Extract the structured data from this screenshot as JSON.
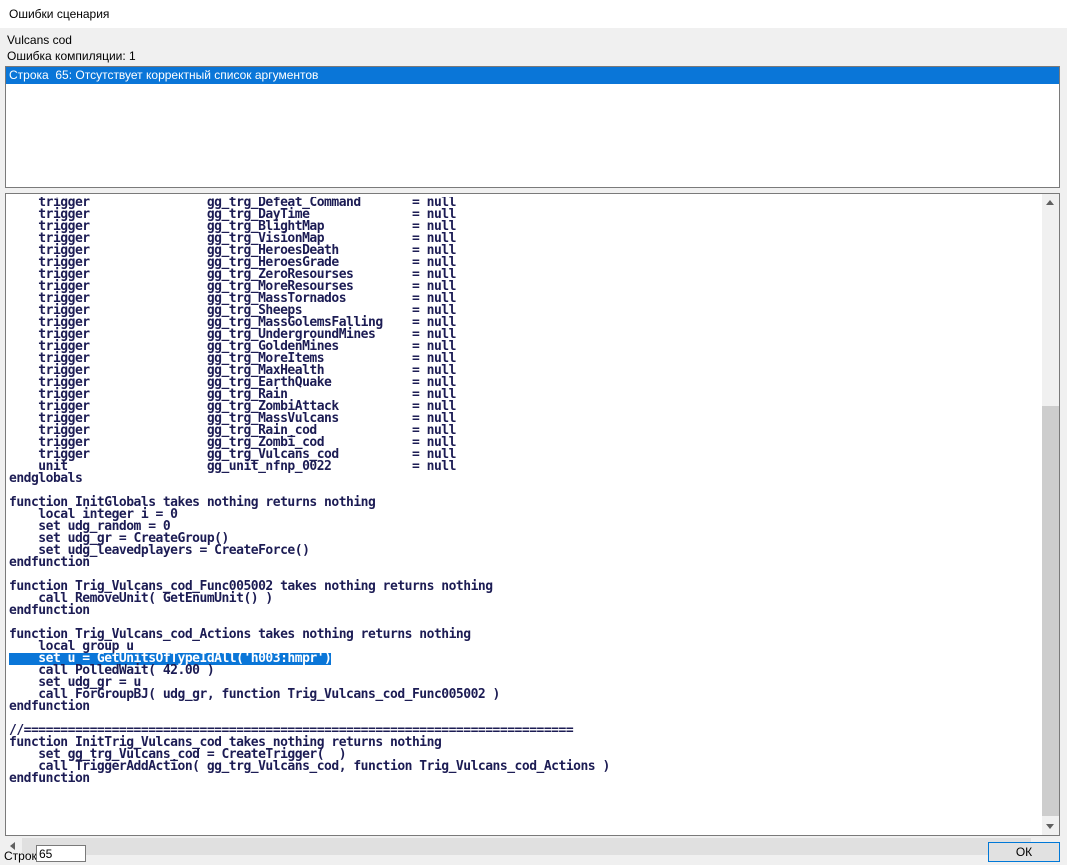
{
  "window": {
    "title": "Ошибки сценария"
  },
  "header": {
    "script_name": "Vulcans cod",
    "error_count": "Ошибка компиляции: 1"
  },
  "error_list": {
    "items": [
      {
        "text": "Строка  65: Отсутствует корректный список аргументов",
        "selected": true
      }
    ]
  },
  "code": {
    "highlighted_index": 38,
    "lines": [
      "    trigger                gg_trg_Defeat_Command       = null",
      "    trigger                gg_trg_DayTime              = null",
      "    trigger                gg_trg_BlightMap            = null",
      "    trigger                gg_trg_VisionMap            = null",
      "    trigger                gg_trg_HeroesDeath          = null",
      "    trigger                gg_trg_HeroesGrade          = null",
      "    trigger                gg_trg_ZeroResourses        = null",
      "    trigger                gg_trg_MoreResourses        = null",
      "    trigger                gg_trg_MassTornados         = null",
      "    trigger                gg_trg_Sheeps               = null",
      "    trigger                gg_trg_MassGolemsFalling    = null",
      "    trigger                gg_trg_UndergroundMines     = null",
      "    trigger                gg_trg_GoldenMines          = null",
      "    trigger                gg_trg_MoreItems            = null",
      "    trigger                gg_trg_MaxHealth            = null",
      "    trigger                gg_trg_EarthQuake           = null",
      "    trigger                gg_trg_Rain                 = null",
      "    trigger                gg_trg_ZombiAttack          = null",
      "    trigger                gg_trg_MassVulcans          = null",
      "    trigger                gg_trg_Rain_cod             = null",
      "    trigger                gg_trg_Zombi_cod            = null",
      "    trigger                gg_trg_Vulcans_cod          = null",
      "    unit                   gg_unit_nfnp_0022           = null",
      "endglobals",
      "",
      "function InitGlobals takes nothing returns nothing",
      "    local integer i = 0",
      "    set udg_random = 0",
      "    set udg_gr = CreateGroup()",
      "    set udg_leavedplayers = CreateForce()",
      "endfunction",
      "",
      "function Trig_Vulcans_cod_Func005002 takes nothing returns nothing",
      "    call RemoveUnit( GetEnumUnit() )",
      "endfunction",
      "",
      "function Trig_Vulcans_cod_Actions takes nothing returns nothing",
      "    local group u",
      "    set u = GetUnitsOfTypeIdAll('h003:hmpr')",
      "    call PolledWait( 42.00 )",
      "    set udg_gr = u",
      "    call ForGroupBJ( udg_gr, function Trig_Vulcans_cod_Func005002 )",
      "endfunction",
      "",
      "//===========================================================================",
      "function InitTrig_Vulcans_cod takes nothing returns nothing",
      "    set gg_trg_Vulcans_cod = CreateTrigger(  )",
      "    call TriggerAddAction( gg_trg_Vulcans_cod, function Trig_Vulcans_cod_Actions )",
      "endfunction"
    ]
  },
  "footer": {
    "line_label": "Строк",
    "line_value": "65",
    "ok_label": "ОК"
  },
  "colors": {
    "selection_bg": "#0a76d8",
    "selection_text": "#ffffff",
    "highlight_bg": "#0a76d8",
    "highlight_text": "#ffffff",
    "code_text": "#1c1c54",
    "window_bg": "#f0f0f0"
  }
}
